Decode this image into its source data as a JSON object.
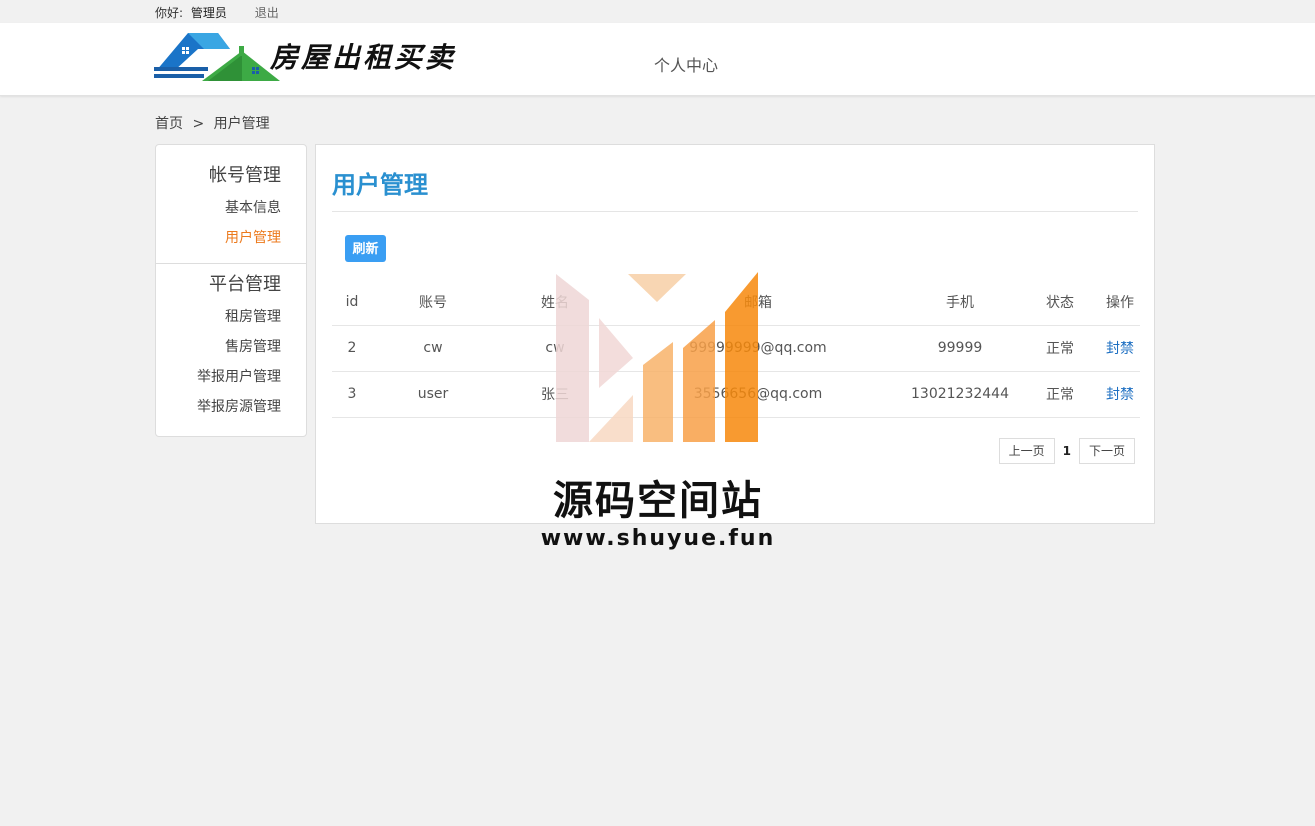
{
  "topbar": {
    "greeting": "你好:",
    "username": "管理员",
    "logout": "退出"
  },
  "header": {
    "site_title": "房屋出租买卖",
    "nav_personal": "个人中心",
    "logo_icon": "house-logo-icon"
  },
  "breadcrumb": {
    "home": "首页",
    "separator": ">",
    "current": "用户管理"
  },
  "sidebar": {
    "account_group": {
      "title": "帐号管理",
      "items": [
        {
          "label": "基本信息"
        },
        {
          "label": "用户管理",
          "active": true
        }
      ]
    },
    "platform_group": {
      "title": "平台管理",
      "items": [
        {
          "label": "租房管理"
        },
        {
          "label": "售房管理"
        },
        {
          "label": "举报用户管理"
        },
        {
          "label": "举报房源管理"
        }
      ]
    }
  },
  "main": {
    "title": "用户管理",
    "refresh_label": "刷新",
    "columns": [
      "id",
      "账号",
      "姓名",
      "邮箱",
      "手机",
      "状态",
      "操作"
    ],
    "rows": [
      {
        "id": "2",
        "account": "cw",
        "name": "cw",
        "email": "99999999@qq.com",
        "phone": "99999",
        "status": "正常",
        "action": "封禁"
      },
      {
        "id": "3",
        "account": "user",
        "name": "张三",
        "email": "3556656@qq.com",
        "phone": "13021232444",
        "status": "正常",
        "action": "封禁"
      }
    ],
    "pager": {
      "prev": "上一页",
      "current": "1",
      "next": "下一页"
    }
  },
  "watermark": {
    "title": "源码空间站",
    "url": "www.shuyue.fun"
  },
  "colors": {
    "accent_blue": "#2a90d0",
    "active_orange": "#ec7a1d",
    "button_blue": "#3a9ef3",
    "link_blue": "#1d6fc2",
    "watermark_orange": "#f7890c"
  }
}
